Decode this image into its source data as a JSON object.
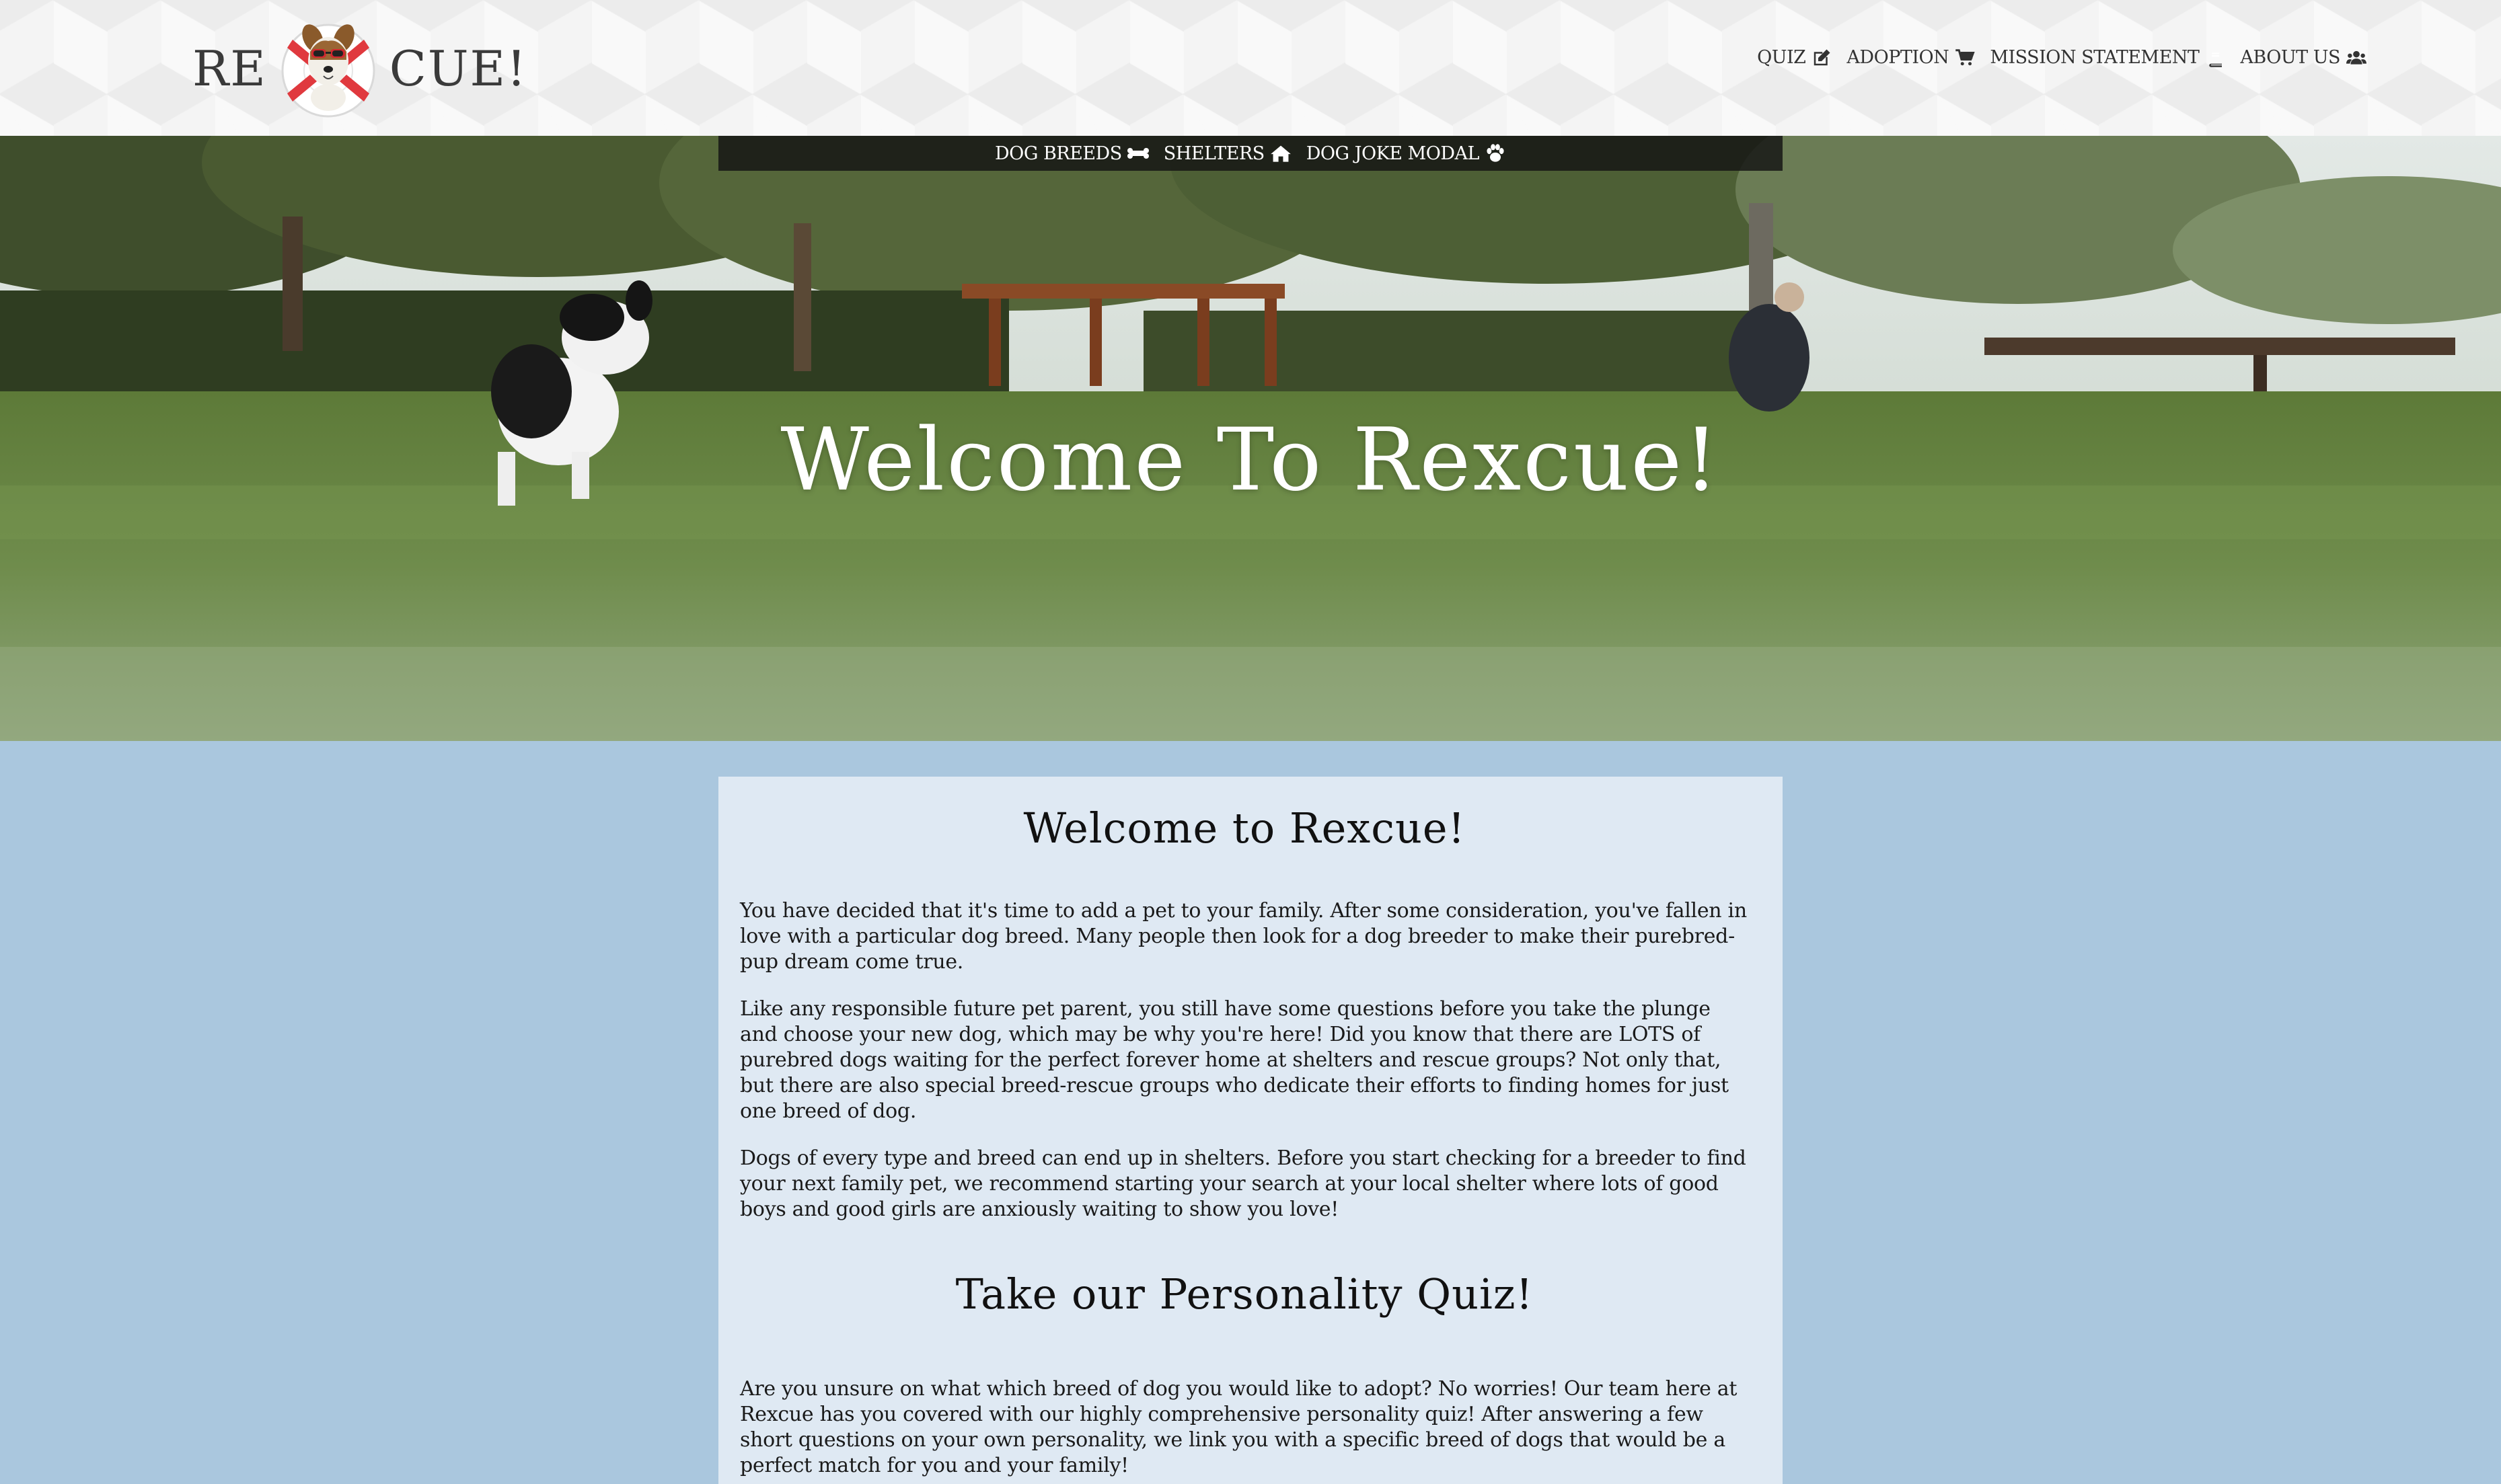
{
  "brand": {
    "logo_left": "RE",
    "logo_right": "CUE!",
    "logo_icon": "dog-lifebuoy-logo"
  },
  "nav": {
    "items": [
      {
        "label": "QUIZ",
        "icon": "edit-icon"
      },
      {
        "label": "ADOPTION",
        "icon": "cart-icon"
      },
      {
        "label": "MISSION STATEMENT",
        "icon": "book-icon"
      },
      {
        "label": "ABOUT US",
        "icon": "users-icon"
      }
    ]
  },
  "subnav": {
    "items": [
      {
        "label": "DOG BREEDS",
        "icon": "bone-icon"
      },
      {
        "label": "SHELTERS",
        "icon": "home-icon"
      },
      {
        "label": "DOG JOKE MODAL",
        "icon": "paw-icon"
      }
    ]
  },
  "hero": {
    "title": "Welcome To Rexcue!"
  },
  "content": {
    "heading1": "Welcome to Rexcue!",
    "p1": "You have decided that it's time to add a pet to your family. After some consideration, you've fallen in love with a particular dog breed. Many people then look for a dog breeder to make their purebred-pup dream come true.",
    "p2": "Like any responsible future pet parent, you still have some questions before you take the plunge and choose your new dog, which may be why you're here! Did you know that there are LOTS of purebred dogs waiting for the perfect forever home at shelters and rescue groups? Not only that, but there are also special breed-rescue groups who dedicate their efforts to finding homes for just one breed of dog.",
    "p3": "Dogs of every type and breed can end up in shelters. Before you start checking for a breeder to find your next family pet, we recommend starting your search at your local shelter where lots of good boys and good girls are anxiously waiting to show you love!",
    "heading2": "Take our Personality Quiz!",
    "p4": "Are you unsure on what which breed of dog you would like to adopt? No worries! Our team here at Rexcue has you covered with our highly comprehensive personality quiz! After answering a few short questions on your own personality, we link you with a specific breed of dogs that would be a perfect match for you and your family!"
  },
  "colors": {
    "page_bg": "#aac7de",
    "card_bg": "#dfe9f3",
    "subnav_bg": "#141414",
    "logo_red": "#e0393e"
  }
}
